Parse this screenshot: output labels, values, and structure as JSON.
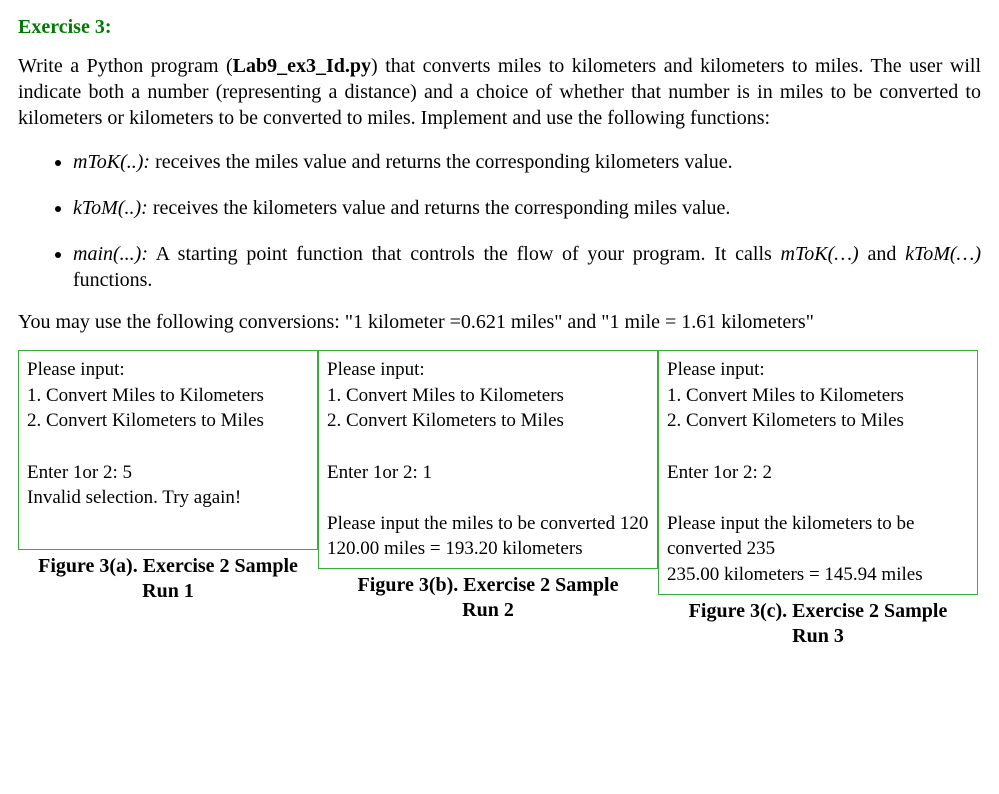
{
  "title": "Exercise 3:",
  "intro_parts": {
    "p1": "Write a Python program (",
    "bold1": "Lab9_ex3_Id.py",
    "p2": ") that converts miles to kilometers and kilometers to miles. The user will indicate both a number (representing a distance) and a choice of whether that number is in miles to be converted to kilometers or kilometers to be converted to miles. Implement and use the following functions:"
  },
  "bullets": [
    {
      "fn": "mToK(..):",
      "desc": " receives the miles value and returns the corresponding kilometers value."
    },
    {
      "fn": "kToM(..):",
      "desc": " receives the kilometers value and returns the corresponding miles value."
    },
    {
      "fn": "main(...):",
      "desc_pre": " A starting point function that controls the flow of your program. It calls ",
      "ref1": "mToK(…)",
      "mid": " and ",
      "ref2": "kToM(…)",
      "desc_post": " functions."
    }
  ],
  "conversion_note": "You may use the following conversions: \"1 kilometer =0.621 miles\" and \"1 mile = 1.61 kilometers\"",
  "samples": [
    {
      "output": "Please input:\n1. Convert Miles to Kilometers\n2. Convert Kilometers to Miles\n\nEnter 1or 2: 5\nInvalid selection. Try again!",
      "caption_line1": "Figure 3(a). Exercise 2 Sample",
      "caption_line2": "Run 1"
    },
    {
      "output": "Please input:\n1. Convert Miles to Kilometers\n2. Convert Kilometers to Miles\n\nEnter 1or 2: 1\n\nPlease input the miles to be converted 120\n120.00 miles = 193.20 kilometers",
      "caption_line1": "Figure 3(b). Exercise 2 Sample",
      "caption_line2": "Run 2"
    },
    {
      "output": "Please input:\n1. Convert Miles to Kilometers\n2. Convert Kilometers to Miles\n\nEnter 1or 2: 2\n\nPlease input the kilometers to be converted 235\n235.00 kilometers = 145.94 miles",
      "caption_line1": "Figure 3(c). Exercise 2 Sample",
      "caption_line2": "Run 3"
    }
  ]
}
